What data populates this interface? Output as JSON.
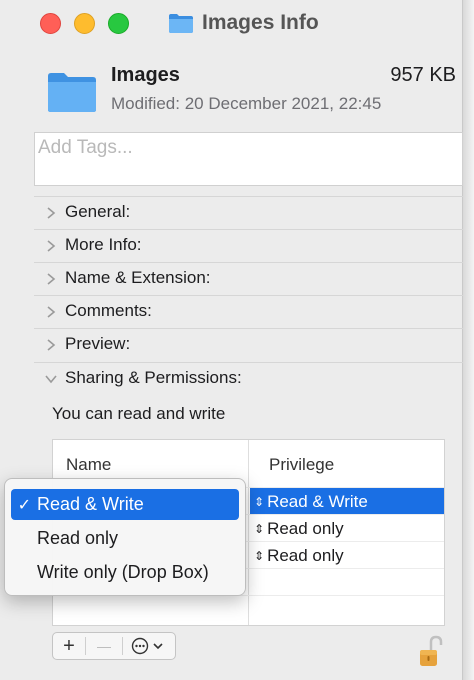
{
  "window": {
    "title": "Images Info"
  },
  "header": {
    "name": "Images",
    "size": "957 KB",
    "modified": "Modified: 20 December 2021, 22:45"
  },
  "tags": {
    "placeholder": "Add Tags..."
  },
  "sections": [
    {
      "label": "General:",
      "expanded": false
    },
    {
      "label": "More Info:",
      "expanded": false
    },
    {
      "label": "Name & Extension:",
      "expanded": false
    },
    {
      "label": "Comments:",
      "expanded": false
    },
    {
      "label": "Preview:",
      "expanded": false
    },
    {
      "label": "Sharing & Permissions:",
      "expanded": true
    }
  ],
  "permissions": {
    "summary": "You can read and write",
    "columns": [
      "Name",
      "Privilege"
    ],
    "rows": [
      {
        "privilege": "Read & Write",
        "selected": true
      },
      {
        "privilege": "Read only",
        "selected": false
      },
      {
        "privilege": "Read only",
        "selected": false
      }
    ]
  },
  "menu": {
    "items": [
      {
        "label": "Read & Write",
        "checked": true
      },
      {
        "label": "Read only",
        "checked": false
      },
      {
        "label": "Write only (Drop Box)",
        "checked": false
      }
    ],
    "check_glyph": "✓"
  },
  "toolbar": {
    "add": "+",
    "remove": "—",
    "stepper_glyph": "⇕"
  },
  "colors": {
    "accent": "#1a6fe4",
    "folder": "#5aa9f0",
    "lock": "#e6a23c"
  }
}
